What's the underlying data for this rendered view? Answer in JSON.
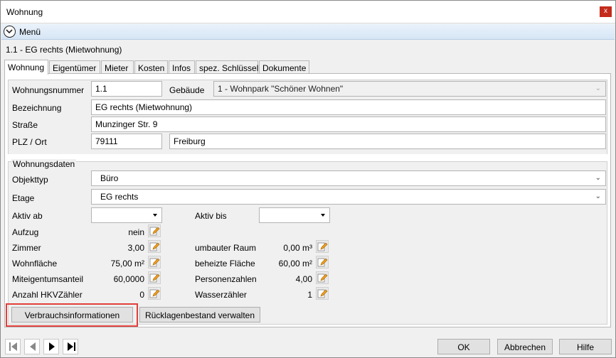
{
  "window": {
    "title": "Wohnung",
    "close": "x"
  },
  "menu": {
    "label": "Menü"
  },
  "record": {
    "title": "1.1 - EG rechts (Mietwohnung)"
  },
  "tabs": [
    {
      "label": "Wohnung"
    },
    {
      "label": "Eigentümer"
    },
    {
      "label": "Mieter"
    },
    {
      "label": "Kosten"
    },
    {
      "label": "Infos"
    },
    {
      "label": "spez. Schlüssel"
    },
    {
      "label": "Dokumente"
    }
  ],
  "form": {
    "wohnungsnummer_label": "Wohnungsnummer",
    "wohnungsnummer": "1.1",
    "gebaeude_label": "Gebäude",
    "gebaeude": "1 - Wohnpark \"Schöner Wohnen\"",
    "bezeichnung_label": "Bezeichnung",
    "bezeichnung": "EG rechts (Mietwohnung)",
    "strasse_label": "Straße",
    "strasse": "Munzinger Str. 9",
    "plz_label": "PLZ / Ort",
    "plz": "79111",
    "ort": "Freiburg"
  },
  "daten": {
    "section_title": "Wohnungsdaten",
    "objekttyp_label": "Objekttyp",
    "objekttyp": "Büro",
    "etage_label": "Etage",
    "etage": "EG rechts",
    "aktiv_ab_label": "Aktiv ab",
    "aktiv_bis_label": "Aktiv bis",
    "aufzug_label": "Aufzug",
    "aufzug": "nein",
    "zimmer_label": "Zimmer",
    "zimmer": "3,00",
    "wohnflaeche_label": "Wohnfläche",
    "wohnflaeche": "75,00 m²",
    "miteigentum_label": "Miteigentumsanteil",
    "miteigentum": "60,0000",
    "hkv_label": "Anzahl HKVZähler",
    "hkv": "0",
    "umbauter_label": "umbauter Raum",
    "umbauter": "0,00 m³",
    "beheizte_label": "beheizte Fläche",
    "beheizte": "60,00 m²",
    "personen_label": "Personenzahlen",
    "personen": "4,00",
    "wasser_label": "Wasserzähler",
    "wasser": "1"
  },
  "buttons": {
    "verbrauch": "Verbrauchsinformationen",
    "ruecklagen": "Rücklagenbestand verwalten",
    "ok": "OK",
    "abbrechen": "Abbrechen",
    "hilfe": "Hilfe"
  },
  "icons": {
    "nav_first": "skip-first-icon",
    "nav_prev": "prev-icon",
    "nav_next": "next-icon",
    "nav_last": "skip-last-icon",
    "edit": "edit-pencil-icon",
    "menu": "chevron-down-circle-icon"
  },
  "colors": {
    "highlight": "#e0403a",
    "close": "#c42b1c",
    "menubar": "#d6e5f5"
  }
}
